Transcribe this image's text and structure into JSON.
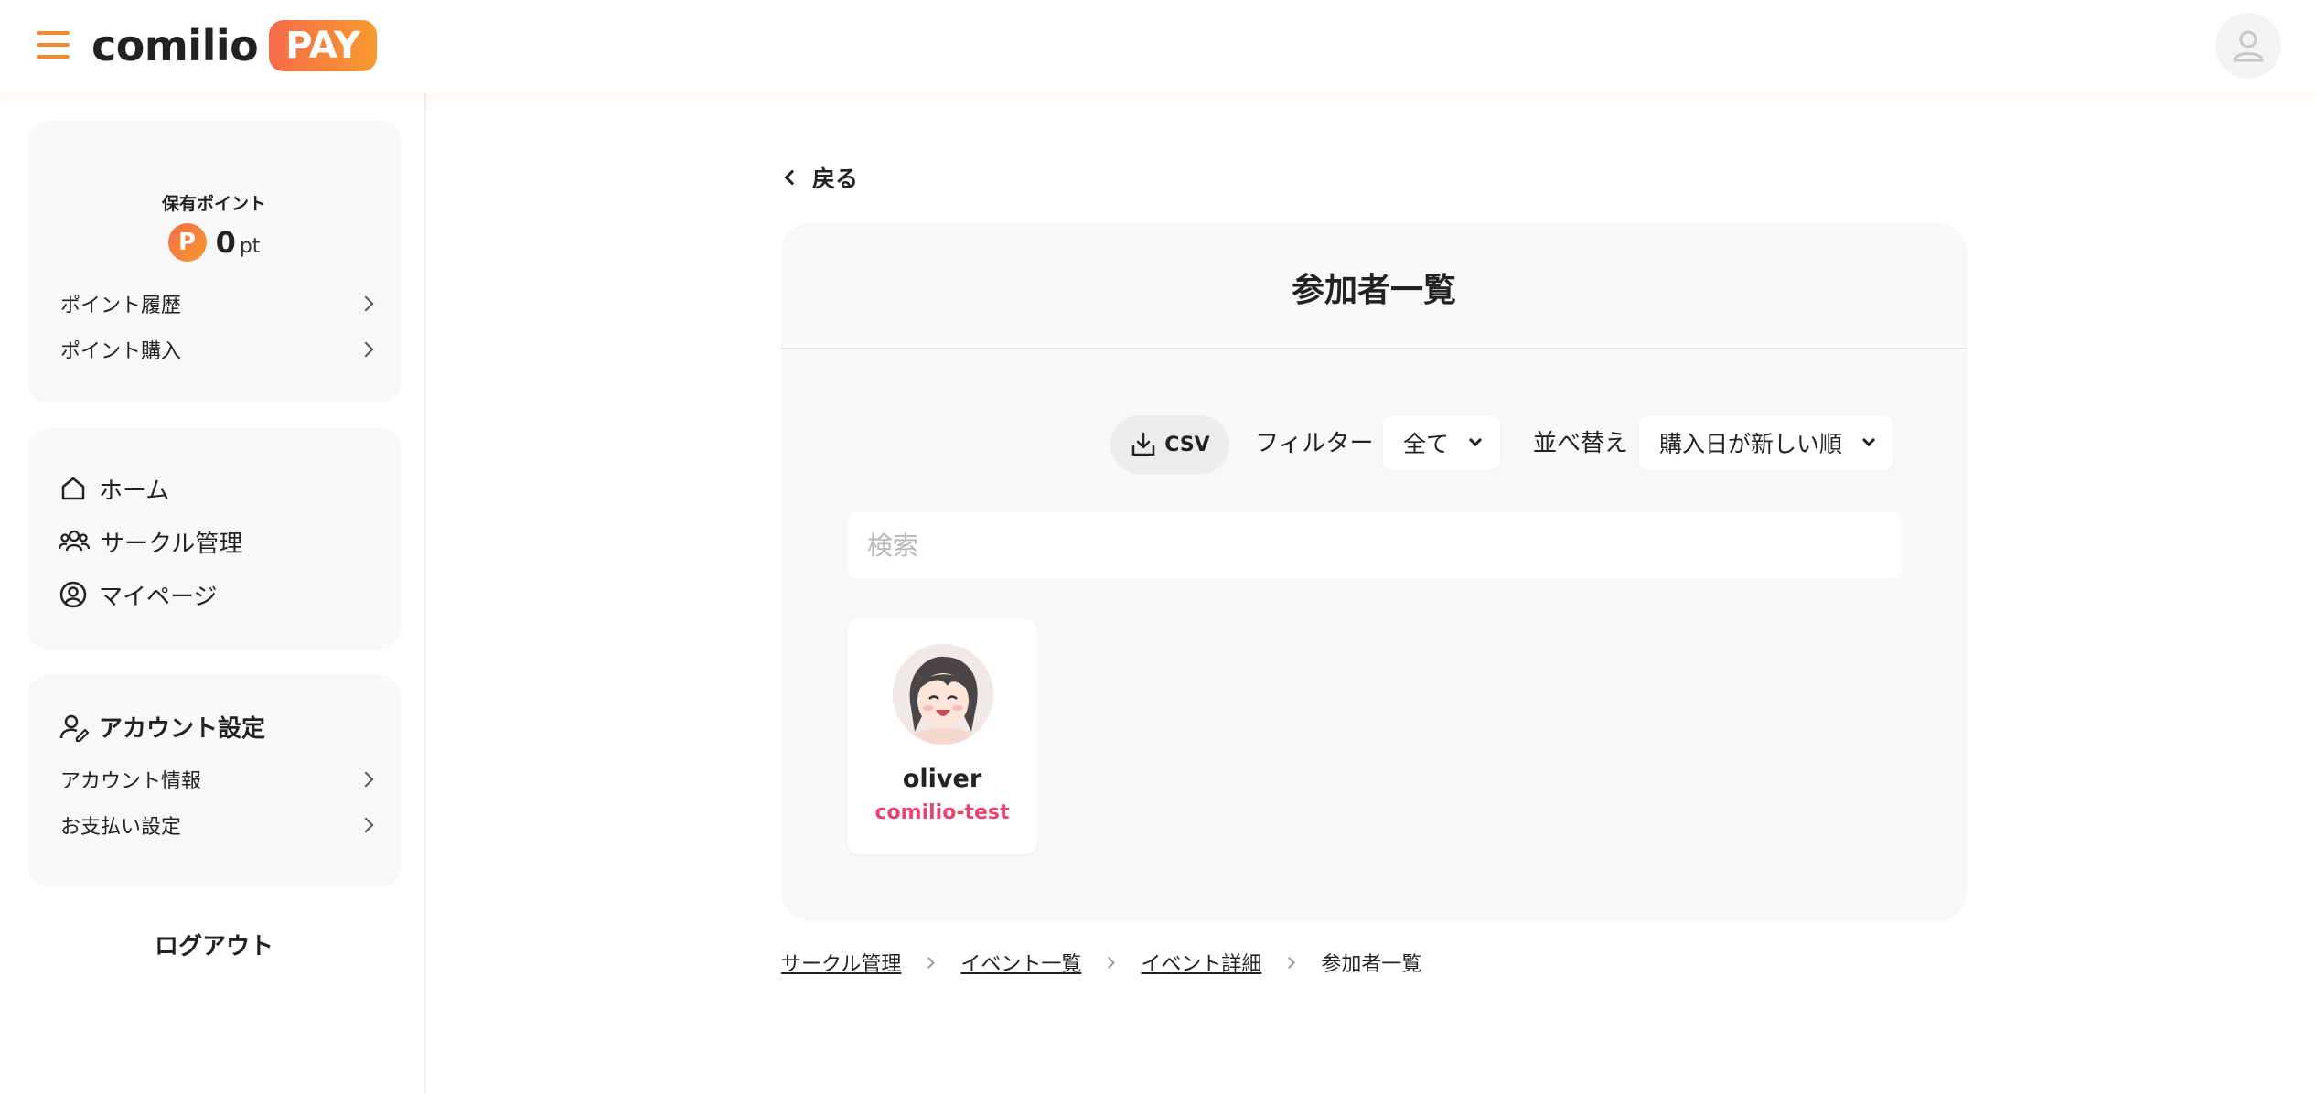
{
  "header": {
    "logo_text": "comilio",
    "logo_badge": "PAY"
  },
  "sidebar": {
    "points": {
      "title": "保有ポイント",
      "badge": "P",
      "value": "0",
      "unit": "pt",
      "links": [
        {
          "label": "ポイント履歴"
        },
        {
          "label": "ポイント購入"
        }
      ]
    },
    "nav": [
      {
        "label": "ホーム",
        "icon": "home-icon"
      },
      {
        "label": "サークル管理",
        "icon": "users-icon"
      },
      {
        "label": "マイページ",
        "icon": "user-circle-icon"
      }
    ],
    "account": {
      "title": "アカウント設定",
      "links": [
        {
          "label": "アカウント情報"
        },
        {
          "label": "お支払い設定"
        }
      ]
    },
    "logout": "ログアウト"
  },
  "main": {
    "back_label": "戻る",
    "title": "参加者一覧",
    "csv_label": "CSV",
    "filter_label": "フィルター",
    "filter_value": "全て",
    "sort_label": "並べ替え",
    "sort_value": "購入日が新しい順",
    "search_placeholder": "検索",
    "participants": [
      {
        "name": "oliver",
        "circle": "comilio-test"
      }
    ]
  },
  "breadcrumb": {
    "items": [
      "サークル管理",
      "イベント一覧",
      "イベント詳細"
    ],
    "current": "参加者一覧"
  },
  "colors": {
    "accent_orange": "#f08a34",
    "pay_gradient_start": "#f56b4b",
    "pay_gradient_end": "#f79a2e",
    "circle_text_pink": "#e8456e"
  }
}
